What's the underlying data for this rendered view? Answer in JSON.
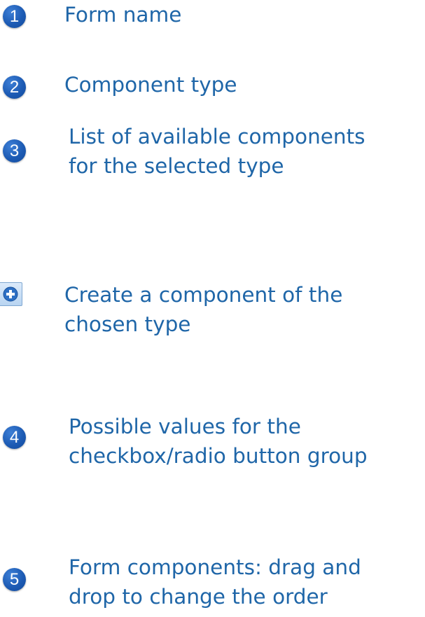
{
  "legend": {
    "items": [
      {
        "badge": "1",
        "text": [
          "Form name"
        ]
      },
      {
        "badge": "2",
        "text": [
          "Component type"
        ]
      },
      {
        "badge": "3",
        "text": [
          "List of available components",
          "for the selected type"
        ]
      },
      {
        "icon": "add-circle-icon",
        "text": [
          "Create a component of the",
          "chosen type"
        ]
      },
      {
        "badge": "4",
        "text": [
          "Possible values for the",
          "checkbox/radio button group"
        ]
      },
      {
        "badge": "5",
        "text": [
          "Form components: drag and",
          "drop to change the order"
        ]
      }
    ]
  },
  "colors": {
    "text": "#1f66a8",
    "badge": "#1d5bb4",
    "icon_bg": "#c9dff5"
  }
}
